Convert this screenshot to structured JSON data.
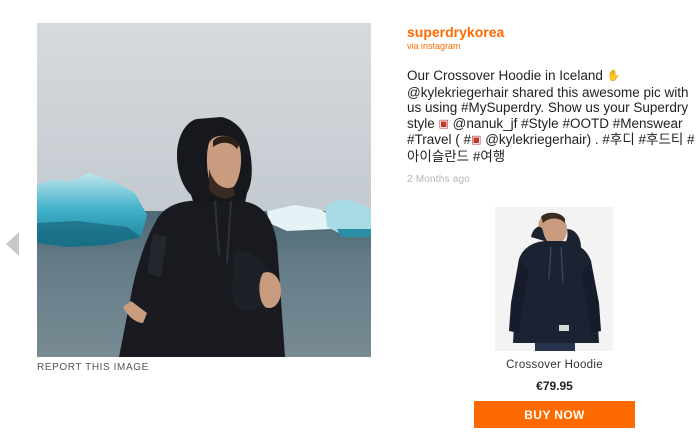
{
  "post": {
    "username": "superdrykorea",
    "via": "via instagram",
    "caption_parts": [
      "Our Crossover Hoodie in Iceland ",
      " @kylekriegerhair shared this awesome pic with us using #MySuperdry. Show us your Superdry style ",
      " @nanuk_jf #Style #OOTD #Menswear #Travel ( #",
      " @kylekriegerhair) . #후디 #후드티 #아이슬란드 #여행"
    ],
    "emoji_icons": [
      "hand-icon",
      "camera-icon",
      "camera-icon"
    ],
    "time": "2 Months ago"
  },
  "report_label": "REPORT THIS IMAGE",
  "product": {
    "name": "Crossover Hoodie",
    "price": "€79.95",
    "buy_label": "BUY NOW"
  },
  "colors": {
    "accent": "#ff6a00",
    "muted": "#b5b5b5"
  }
}
